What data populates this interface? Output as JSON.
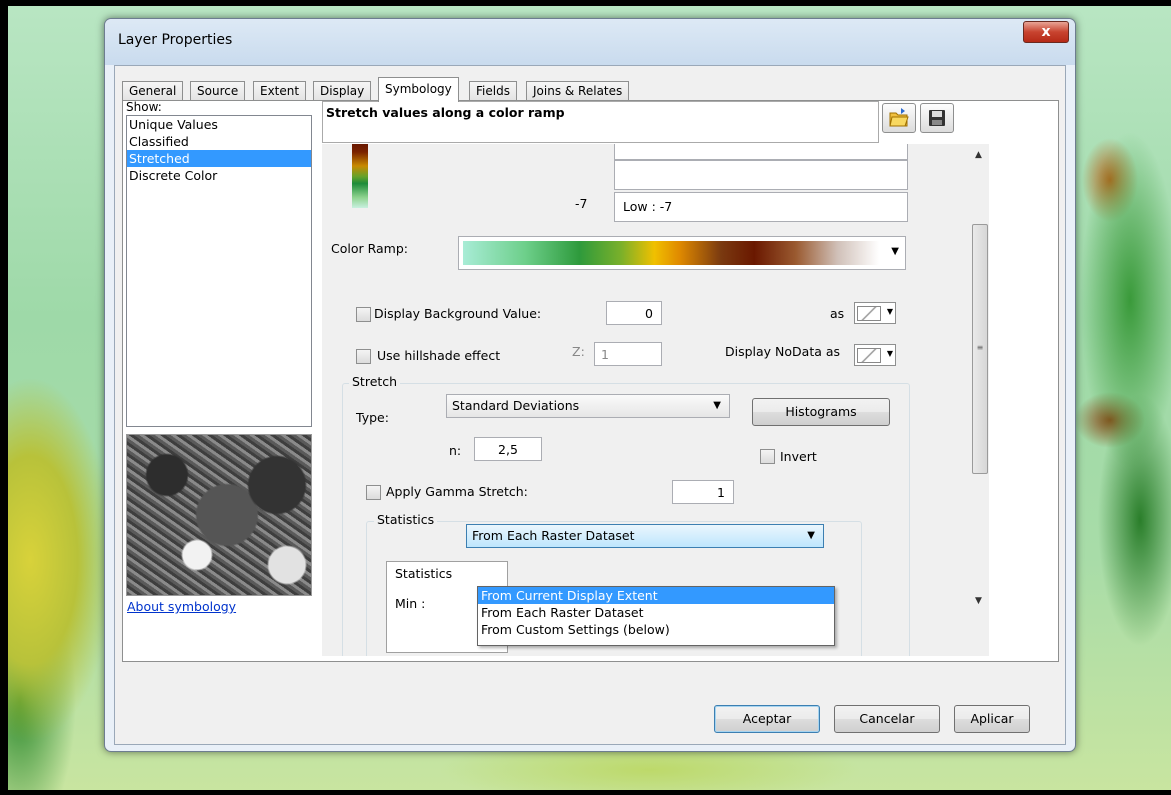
{
  "window": {
    "title": "Layer Properties",
    "close_label": "x"
  },
  "tabs": [
    {
      "label": "General"
    },
    {
      "label": "Source"
    },
    {
      "label": "Extent"
    },
    {
      "label": "Display"
    },
    {
      "label": "Symbology",
      "active": true
    },
    {
      "label": "Fields"
    },
    {
      "label": "Joins & Relates"
    }
  ],
  "left_panel": {
    "show_label": "Show:",
    "items": [
      "Unique Values",
      "Classified",
      "Stretched",
      "Discrete Color"
    ],
    "selected": "Stretched",
    "about_link": "About symbology"
  },
  "symbology": {
    "heading": "Stretch values along a color ramp",
    "legend": {
      "low_value": "-7",
      "low_label": "Low : -7"
    },
    "color_ramp_label": "Color Ramp:",
    "display_background": {
      "label": "Display Background Value:",
      "checked": false,
      "value": "0",
      "as_label": "as"
    },
    "hillshade": {
      "label": "Use hillshade effect",
      "checked": false,
      "z_label": "Z:",
      "z_value": "1"
    },
    "nodata_label": "Display NoData as",
    "stretch": {
      "group_title": "Stretch",
      "type_label": "Type:",
      "type_value": "Standard Deviations",
      "histograms_label": "Histograms",
      "n_label": "n:",
      "n_value": "2,5",
      "invert_label": "Invert",
      "invert_checked": false,
      "gamma_label": "Apply Gamma Stretch:",
      "gamma_checked": false,
      "gamma_value": "1"
    },
    "statistics": {
      "group_title": "Statistics",
      "selected": "From Each Raster Dataset",
      "options": [
        "From Current Display Extent",
        "From Each Raster Dataset",
        "From Custom Settings (below)"
      ],
      "hovered": "From Current Display Extent",
      "inner_label": "Statistics",
      "min_label": "Min :"
    }
  },
  "footer": {
    "ok_label": "Aceptar",
    "cancel_label": "Cancelar",
    "apply_label": "Aplicar"
  }
}
